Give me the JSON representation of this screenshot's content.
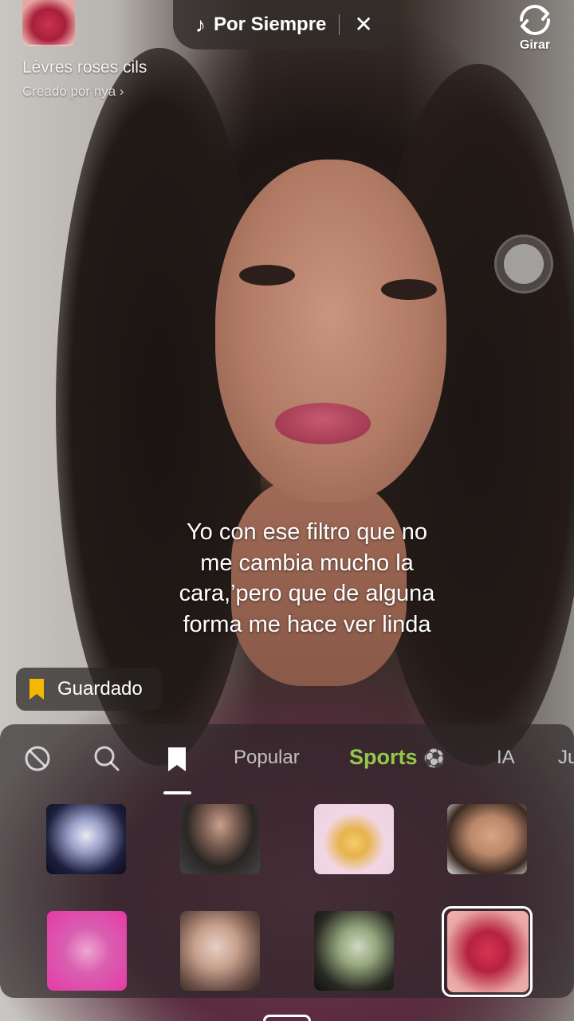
{
  "effect": {
    "title": "Lèvres roses cils",
    "creator": "Creado por nya",
    "thumb_icon": "lips-thumbnail"
  },
  "sound": {
    "label": "Por Siempre",
    "note_glyph": "♪",
    "close_glyph": "✕"
  },
  "camera": {
    "flip_label": "Girar"
  },
  "caption": {
    "line1": "Yo con ese filtro que no",
    "line2": "me cambia mucho la",
    "line3": "cara,’pero que de alguna",
    "line4": "forma me hace ver linda"
  },
  "saved_chip": {
    "label": "Guardado",
    "accent": "#f5b800"
  },
  "tabs": {
    "popular": "Popular",
    "sports": "Sports",
    "ia": "IA",
    "next": "Ju",
    "sports_color": "#93c84b"
  },
  "effect_grid": [
    {
      "name": "effect-tile-anime-girl",
      "row": 1
    },
    {
      "name": "effect-tile-woman-black-shirt",
      "row": 1
    },
    {
      "name": "effect-tile-flan-dessert",
      "row": 1
    },
    {
      "name": "effect-tile-woman-portrait",
      "row": 1
    },
    {
      "name": "effect-tile-pink-creature",
      "row": 2
    },
    {
      "name": "effect-tile-girl-headphones",
      "row": 2
    },
    {
      "name": "effect-tile-girl-green-headphones",
      "row": 2
    },
    {
      "name": "effect-tile-pink-lips",
      "row": 2,
      "selected": true
    }
  ]
}
